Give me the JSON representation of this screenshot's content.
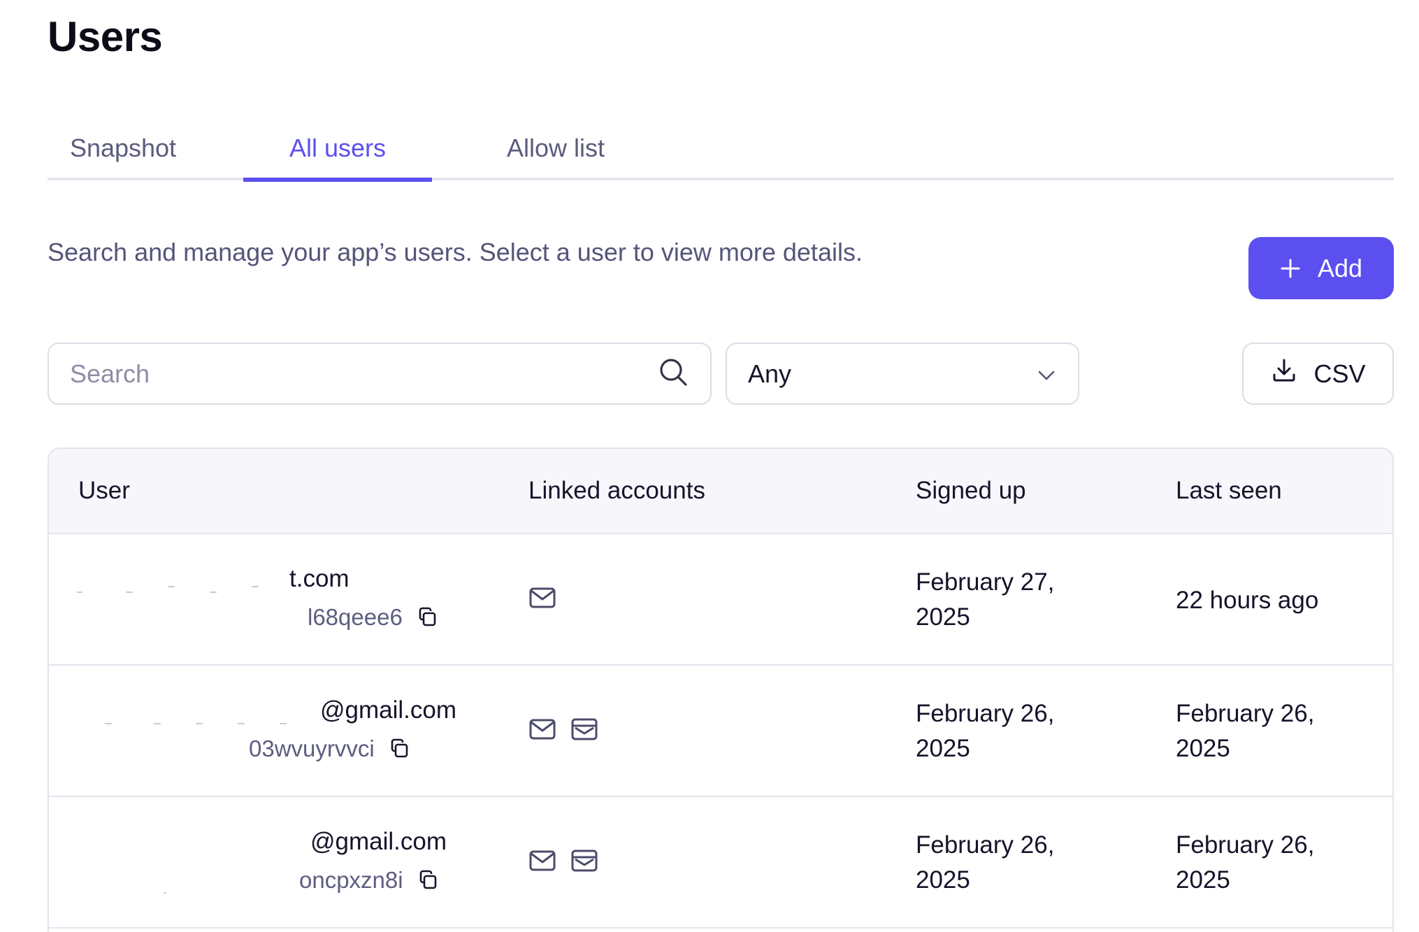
{
  "page": {
    "title": "Users"
  },
  "tabs": [
    {
      "label": "Snapshot",
      "active": false
    },
    {
      "label": "All users",
      "active": true
    },
    {
      "label": "Allow list",
      "active": false
    }
  ],
  "description": "Search and manage your app’s users. Select a user to view more details.",
  "add_button": {
    "label": "Add",
    "icon": "plus-icon"
  },
  "search": {
    "placeholder": "Search",
    "value": "",
    "icon": "search-icon"
  },
  "filter": {
    "value": "Any",
    "icon": "chevron-down-icon"
  },
  "csv_button": {
    "label": "CSV",
    "icon": "download-icon"
  },
  "table": {
    "columns": [
      "User",
      "Linked accounts",
      "Signed up",
      "Last seen"
    ],
    "rows": [
      {
        "email": "t.com",
        "id": "l68qeee6",
        "linked_accounts": [
          "mail-icon"
        ],
        "signed_up": [
          "February 27,",
          "2025"
        ],
        "last_seen": [
          "22 hours ago"
        ]
      },
      {
        "email": "@gmail.com",
        "id": "03wvuyrvvci",
        "linked_accounts": [
          "mail-icon",
          "inbox-icon"
        ],
        "signed_up": [
          "February 26,",
          "2025"
        ],
        "last_seen": [
          "February 26,",
          "2025"
        ]
      },
      {
        "email": "@gmail.com",
        "id": "oncpxzn8i",
        "linked_accounts": [
          "mail-icon",
          "inbox-icon"
        ],
        "signed_up": [
          "February 26,",
          "2025"
        ],
        "last_seen": [
          "February 26,",
          "2025"
        ]
      }
    ]
  },
  "colors": {
    "accent": "#5b4ff0",
    "border": "#dcdde6",
    "header_bg": "#f7f7fb",
    "muted_text": "#5d5d80"
  }
}
